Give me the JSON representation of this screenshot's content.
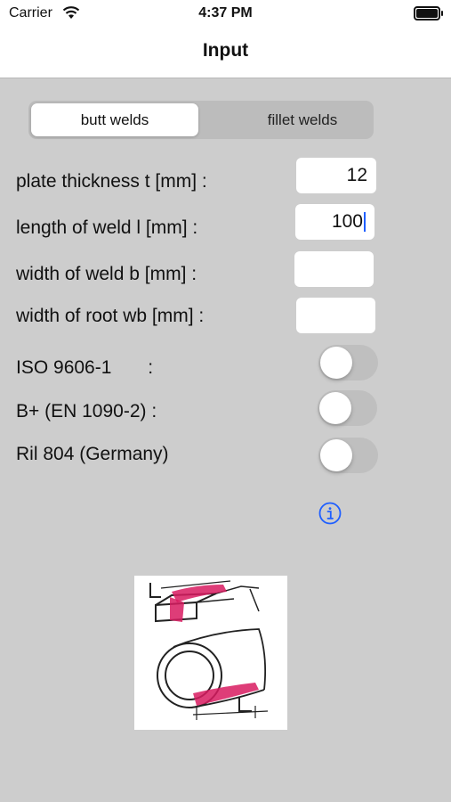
{
  "status": {
    "carrier": "Carrier",
    "time": "4:37 PM"
  },
  "nav": {
    "title": "Input"
  },
  "segmented": {
    "options": [
      "butt welds",
      "fillet welds"
    ],
    "selected": "butt welds"
  },
  "fields": [
    {
      "label": "plate thickness t [mm] :",
      "value": "12"
    },
    {
      "label": "length of weld l [mm] :",
      "value": "100"
    },
    {
      "label": "width of weld b [mm] :",
      "value": ""
    },
    {
      "label": "width of root wb [mm] :",
      "value": ""
    }
  ],
  "toggles": [
    {
      "label": "ISO 9606-1       :",
      "on": false
    },
    {
      "label": "B+ (EN 1090-2) :",
      "on": false
    },
    {
      "label": "Ril 804 (Germany)",
      "on": false
    }
  ],
  "icons": {
    "info": "info-icon",
    "wifi": "wifi-icon",
    "battery": "battery-icon"
  },
  "colors": {
    "background": "#cdcdcd",
    "accent": "#1f5fff",
    "weld": "#d81b60"
  }
}
